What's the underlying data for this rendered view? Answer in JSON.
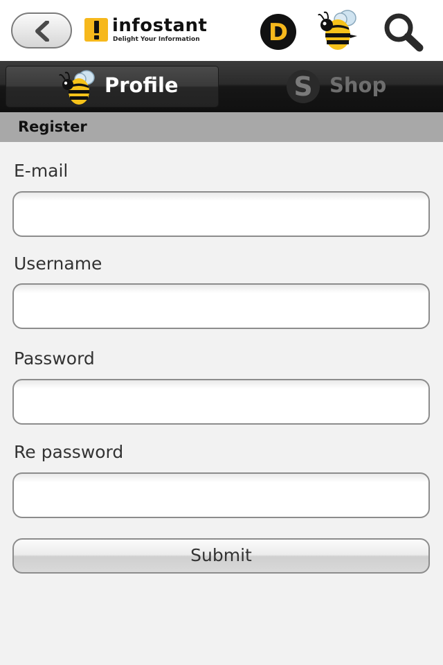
{
  "header": {
    "brand_name": "infostant",
    "brand_tagline": "Delight Your Information",
    "d_badge": "D"
  },
  "tabs": [
    {
      "label": "Profile",
      "active": true
    },
    {
      "label": "Shop",
      "active": false,
      "icon_letter": "S"
    }
  ],
  "section": {
    "title": "Register"
  },
  "form": {
    "email": {
      "label": "E-mail",
      "value": "",
      "placeholder": ""
    },
    "username": {
      "label": "Username",
      "value": "",
      "placeholder": ""
    },
    "password": {
      "label": "Password",
      "value": "",
      "placeholder": ""
    },
    "repassword": {
      "label": "Re password",
      "value": "",
      "placeholder": ""
    },
    "submit_label": "Submit"
  },
  "colors": {
    "brand_accent": "#f6b81c",
    "tabbar_dark": "#161616",
    "section_header": "#a8a8a8",
    "page_bg": "#f2f2f2"
  }
}
